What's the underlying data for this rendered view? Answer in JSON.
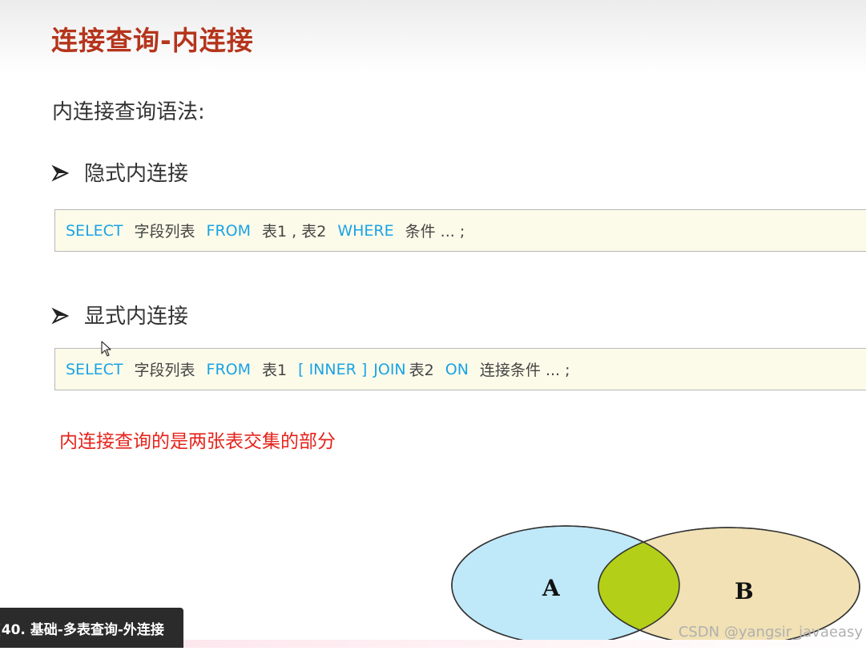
{
  "slide": {
    "title": "连接查询-内连接",
    "subtitle": "内连接查询语法:",
    "implicit": {
      "heading": "隐式内连接",
      "code": {
        "select": "SELECT",
        "fields": "字段列表",
        "from": "FROM",
        "tables": "表1 , 表2",
        "where": "WHERE",
        "cond": "条件 ... ;"
      }
    },
    "explicit": {
      "heading": "显式内连接",
      "code": {
        "select": "SELECT",
        "fields": "字段列表",
        "from": "FROM",
        "table1": "表1",
        "inner": "[ INNER ]",
        "join": "JOIN",
        "table2": "表2",
        "on": "ON",
        "cond": "连接条件 ... ;"
      }
    },
    "note": "内连接查询的是两张表交集的部分",
    "venn": {
      "label_a": "A",
      "label_b": "B",
      "colors": {
        "a_fill": "#bfe9f9",
        "b_fill": "#f1e1b4",
        "intersection": "#b3cf17",
        "stroke": "#333333"
      }
    }
  },
  "overlay": {
    "video_title": "(40. 基础-多表查询-外连接",
    "watermark": "CSDN @yangsir_javaeasy"
  },
  "icons": {
    "bullet": "arrowhead-bullet-icon",
    "cursor": "mouse-pointer-icon"
  },
  "colors": {
    "title": "#b5351c",
    "keyword": "#1aa3e6",
    "note": "#e5231b",
    "code_bg": "#fcfbe9"
  }
}
